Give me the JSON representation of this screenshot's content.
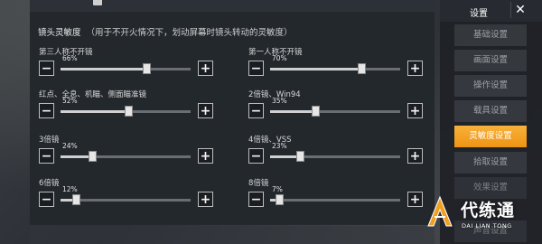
{
  "section": {
    "title": "镜头灵敏度",
    "subtitle": "（用于不开火情况下，划动屏幕时镜头转动的灵敏度）"
  },
  "sliders": [
    {
      "label": "第三人称不开镜",
      "percent_text": "66%",
      "value": 0.66
    },
    {
      "label": "第一人称不开镜",
      "percent_text": "70%",
      "value": 0.7
    },
    {
      "label": "红点、全息、机瞄、侧面瞄准镜",
      "percent_text": "52%",
      "value": 0.52
    },
    {
      "label": "2倍镜、Win94",
      "percent_text": "35%",
      "value": 0.35
    },
    {
      "label": "3倍镜",
      "percent_text": "24%",
      "value": 0.24
    },
    {
      "label": "4倍镜、VSS",
      "percent_text": "23%",
      "value": 0.23
    },
    {
      "label": "6倍镜",
      "percent_text": "12%",
      "value": 0.12
    },
    {
      "label": "8倍镜",
      "percent_text": "7%",
      "value": 0.07
    }
  ],
  "buttons": {
    "minus": "−",
    "plus": "+"
  },
  "sidebar": {
    "title": "设置",
    "close": "✕",
    "items": [
      {
        "label": "基础设置"
      },
      {
        "label": "画面设置"
      },
      {
        "label": "操作设置"
      },
      {
        "label": "载具设置"
      },
      {
        "label": "灵敏度设置",
        "active": true
      },
      {
        "label": "拾取设置"
      },
      {
        "label": "效果设置"
      },
      {
        "label": "声音设置"
      }
    ]
  },
  "watermark": {
    "cn": "代练通",
    "en": "DAI LIAN TONG"
  },
  "colors": {
    "accent": "#f5a623",
    "panel": "#24282e"
  }
}
